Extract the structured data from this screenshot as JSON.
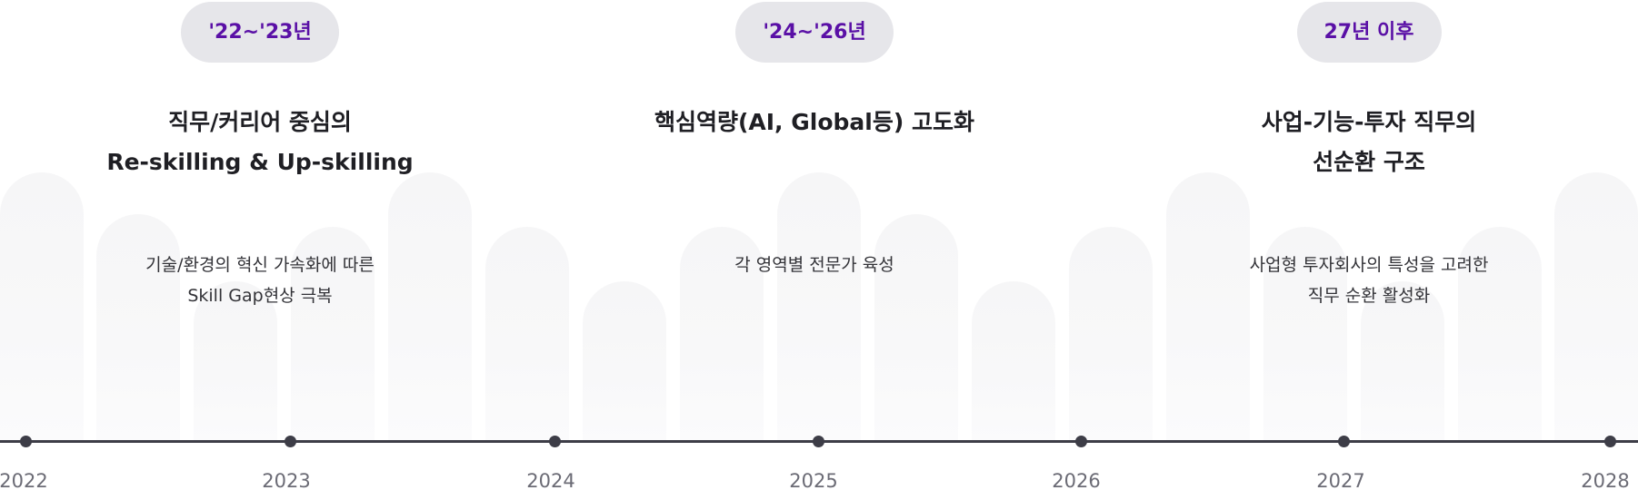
{
  "phases": [
    {
      "badge": "'22~'23년",
      "title_lines": [
        "직무/커리어 중심의",
        "Re-skilling & Up-skilling"
      ],
      "desc_lines": [
        "기술/환경의 혁신 가속화에 따른",
        "Skill Gap현상 극복"
      ]
    },
    {
      "badge": "'24~'26년",
      "title_lines": [
        "핵심역량(AI, Global등) 고도화",
        ""
      ],
      "desc_lines": [
        "각 영역별 전문가 육성",
        ""
      ]
    },
    {
      "badge": "27년 이후",
      "title_lines": [
        "사업-기능-투자 직무의",
        "선순환 구조"
      ],
      "desc_lines": [
        "사업형 투자회사의 특성을 고려한",
        "직무 순환 활성화"
      ]
    }
  ],
  "timeline": {
    "years": [
      "2022",
      "2023",
      "2024",
      "2025",
      "2026",
      "2027",
      "2028"
    ]
  },
  "colors": {
    "badge_bg": "#e6e6ea",
    "badge_text": "#5a10a6",
    "line": "#3d3d47",
    "year_text": "#6b6b75"
  }
}
